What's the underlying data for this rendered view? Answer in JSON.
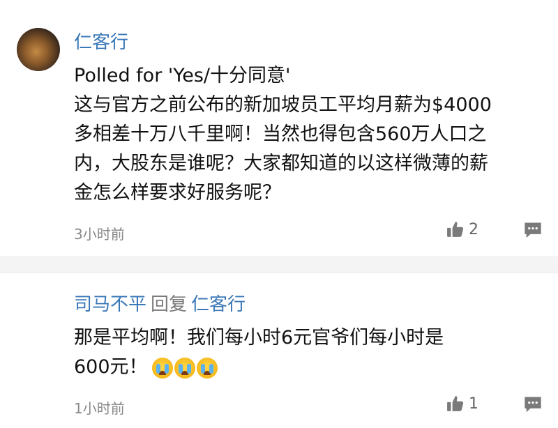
{
  "comments": [
    {
      "author": "仁客行",
      "body_lines": [
        "Polled for 'Yes/十分同意'",
        "这与官方之前公布的新加坡员工平均月薪为$4000",
        "多相差十万八千里啊！当然也得包含560万人口之",
        "内，大股东是谁呢？大家都知道的以这样微薄的薪",
        "金怎么样要求好服务呢？"
      ],
      "time": "3小时前",
      "likes": "2",
      "like_icon": "thumbs-up-icon",
      "reply_icon": "comment-bubble-icon"
    },
    {
      "author": "司马不平",
      "reply_word": "回复",
      "reply_to": "仁客行",
      "body_lines": [
        "那是平均啊！我们每小时6元官爷们每小时是",
        "600元！"
      ],
      "emoji_count": 3,
      "emoji_icon": "loudly-crying-face-icon",
      "time": "1小时前",
      "likes": "1",
      "like_icon": "thumbs-up-icon",
      "reply_icon": "comment-bubble-icon"
    }
  ],
  "colors": {
    "name": "#3a78b8",
    "text": "#111111",
    "meta": "#888888",
    "icon": "#7a7a7a",
    "divider": "#f4f4f4"
  }
}
